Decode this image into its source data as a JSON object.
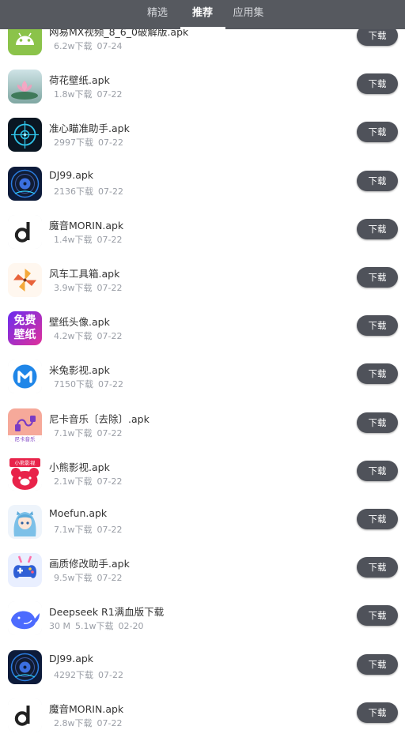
{
  "tabs": [
    {
      "label": "精选",
      "active": false
    },
    {
      "label": "推荐",
      "active": true
    },
    {
      "label": "应用集",
      "active": false
    }
  ],
  "download_label": "下载",
  "apps": [
    {
      "name": "网易MX视频_8_6_0破解版.apk",
      "size": "",
      "downloads": "6.2w下载",
      "date": "07-24",
      "icon": "android-icon"
    },
    {
      "name": "荷花壁纸.apk",
      "size": "",
      "downloads": "1.8w下载",
      "date": "07-22",
      "icon": "lotus-icon"
    },
    {
      "name": "准心瞄准助手.apk",
      "size": "",
      "downloads": "2997下载",
      "date": "07-22",
      "icon": "crosshair-icon"
    },
    {
      "name": "DJ99.apk",
      "size": "",
      "downloads": "2136下载",
      "date": "07-22",
      "icon": "vinyl-disc-icon"
    },
    {
      "name": "魔音MORIN.apk",
      "size": "",
      "downloads": "1.4w下载",
      "date": "07-22",
      "icon": "music-note-d-icon"
    },
    {
      "name": "风车工具箱.apk",
      "size": "",
      "downloads": "3.9w下载",
      "date": "07-22",
      "icon": "pinwheel-icon"
    },
    {
      "name": "壁纸头像.apk",
      "size": "",
      "downloads": "4.2w下载",
      "date": "07-22",
      "icon": "free-wallpaper-icon",
      "icon_text": [
        "免费",
        "壁纸"
      ]
    },
    {
      "name": "米兔影视.apk",
      "size": "",
      "downloads": "7150下载",
      "date": "07-22",
      "icon": "m-logo-icon"
    },
    {
      "name": "尼卡音乐〔去除〕.apk",
      "size": "",
      "downloads": "7.1w下载",
      "date": "07-22",
      "icon": "music-cable-icon",
      "icon_text": [
        "尼卡音乐"
      ]
    },
    {
      "name": "小熊影视.apk",
      "size": "",
      "downloads": "2.1w下载",
      "date": "07-22",
      "icon": "bear-icon",
      "icon_text": [
        "小熊影视"
      ]
    },
    {
      "name": "Moefun.apk",
      "size": "",
      "downloads": "7.1w下载",
      "date": "07-22",
      "icon": "anime-girl-icon"
    },
    {
      "name": "画质修改助手.apk",
      "size": "",
      "downloads": "9.5w下载",
      "date": "07-22",
      "icon": "gamepad-icon"
    },
    {
      "name": "Deepseek R1满血版下载",
      "size": "30 M",
      "downloads": "5.1w下载",
      "date": "02-20",
      "icon": "whale-icon"
    },
    {
      "name": "DJ99.apk",
      "size": "",
      "downloads": "4292下载",
      "date": "07-22",
      "icon": "vinyl-disc-icon"
    },
    {
      "name": "魔音MORIN.apk",
      "size": "",
      "downloads": "2.8w下载",
      "date": "07-22",
      "icon": "music-note-d-icon"
    }
  ]
}
